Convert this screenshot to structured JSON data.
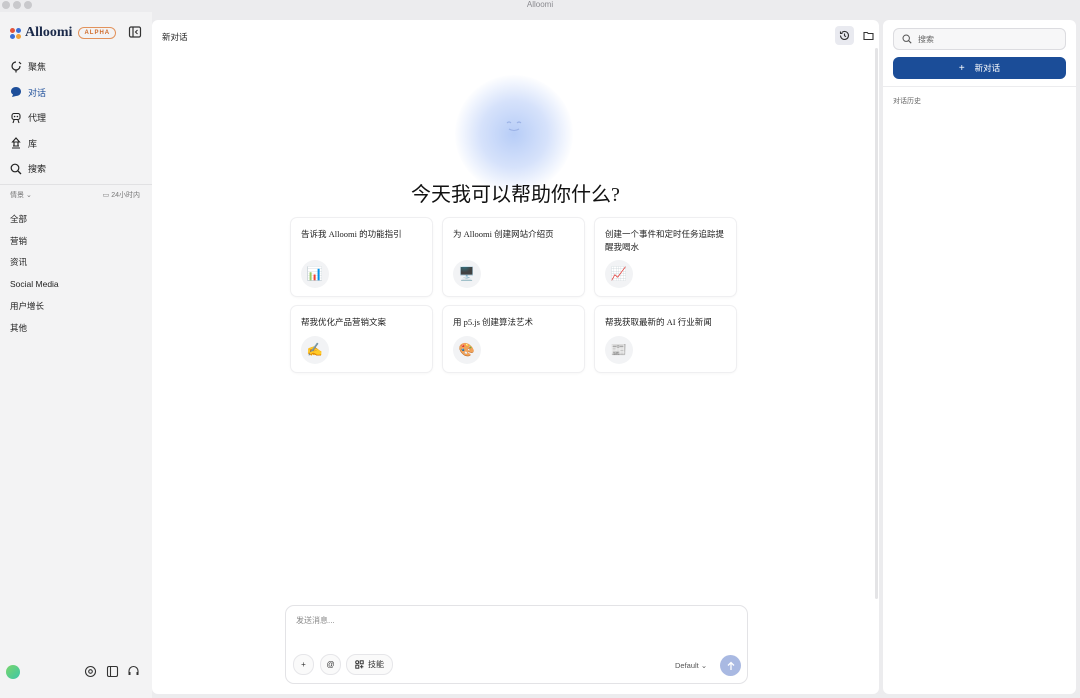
{
  "window": {
    "title": "Alloomi"
  },
  "sidebar": {
    "brand": "Alloomi",
    "badge": "ALPHA",
    "nav": [
      {
        "label": "聚焦",
        "icon": "focus-icon",
        "active": false
      },
      {
        "label": "对话",
        "icon": "chat-icon",
        "active": true
      },
      {
        "label": "代理",
        "icon": "agent-icon",
        "active": false
      },
      {
        "label": "库",
        "icon": "library-icon",
        "active": false
      },
      {
        "label": "搜索",
        "icon": "search-icon",
        "active": false
      }
    ],
    "filter_label": "情景",
    "time_label": "24小时内",
    "categories": [
      "全部",
      "营销",
      "资讯",
      "Social Media",
      "用户增长",
      "其他"
    ]
  },
  "main": {
    "title": "新对话",
    "heading": "今天我可以帮助你什么?",
    "suggestions": [
      {
        "text": "告诉我 Alloomi 的功能指引",
        "emoji": "📊"
      },
      {
        "text": "为 Alloomi 创建网站介绍页",
        "emoji": "🖥️"
      },
      {
        "text": "创建一个事件和定时任务追踪提醒我喝水",
        "emoji": "📈"
      },
      {
        "text": "帮我优化产品营销文案",
        "emoji": "✍️"
      },
      {
        "text": "用 p5.js 创建算法艺术",
        "emoji": "🎨"
      },
      {
        "text": "帮我获取最新的 AI 行业新闻",
        "emoji": "📰"
      }
    ],
    "composer": {
      "placeholder": "发送消息...",
      "plus_label": "+",
      "mention_label": "@",
      "skills_label": "技能",
      "model": "Default"
    }
  },
  "right_panel": {
    "search_placeholder": "搜索",
    "new_chat_label": "新对话",
    "new_chat_plus": "+",
    "history_label": "对话历史"
  },
  "colors": {
    "accent": "#1b4d98",
    "active_nav": "#1d4e9a",
    "badge": "#d06b2a"
  }
}
